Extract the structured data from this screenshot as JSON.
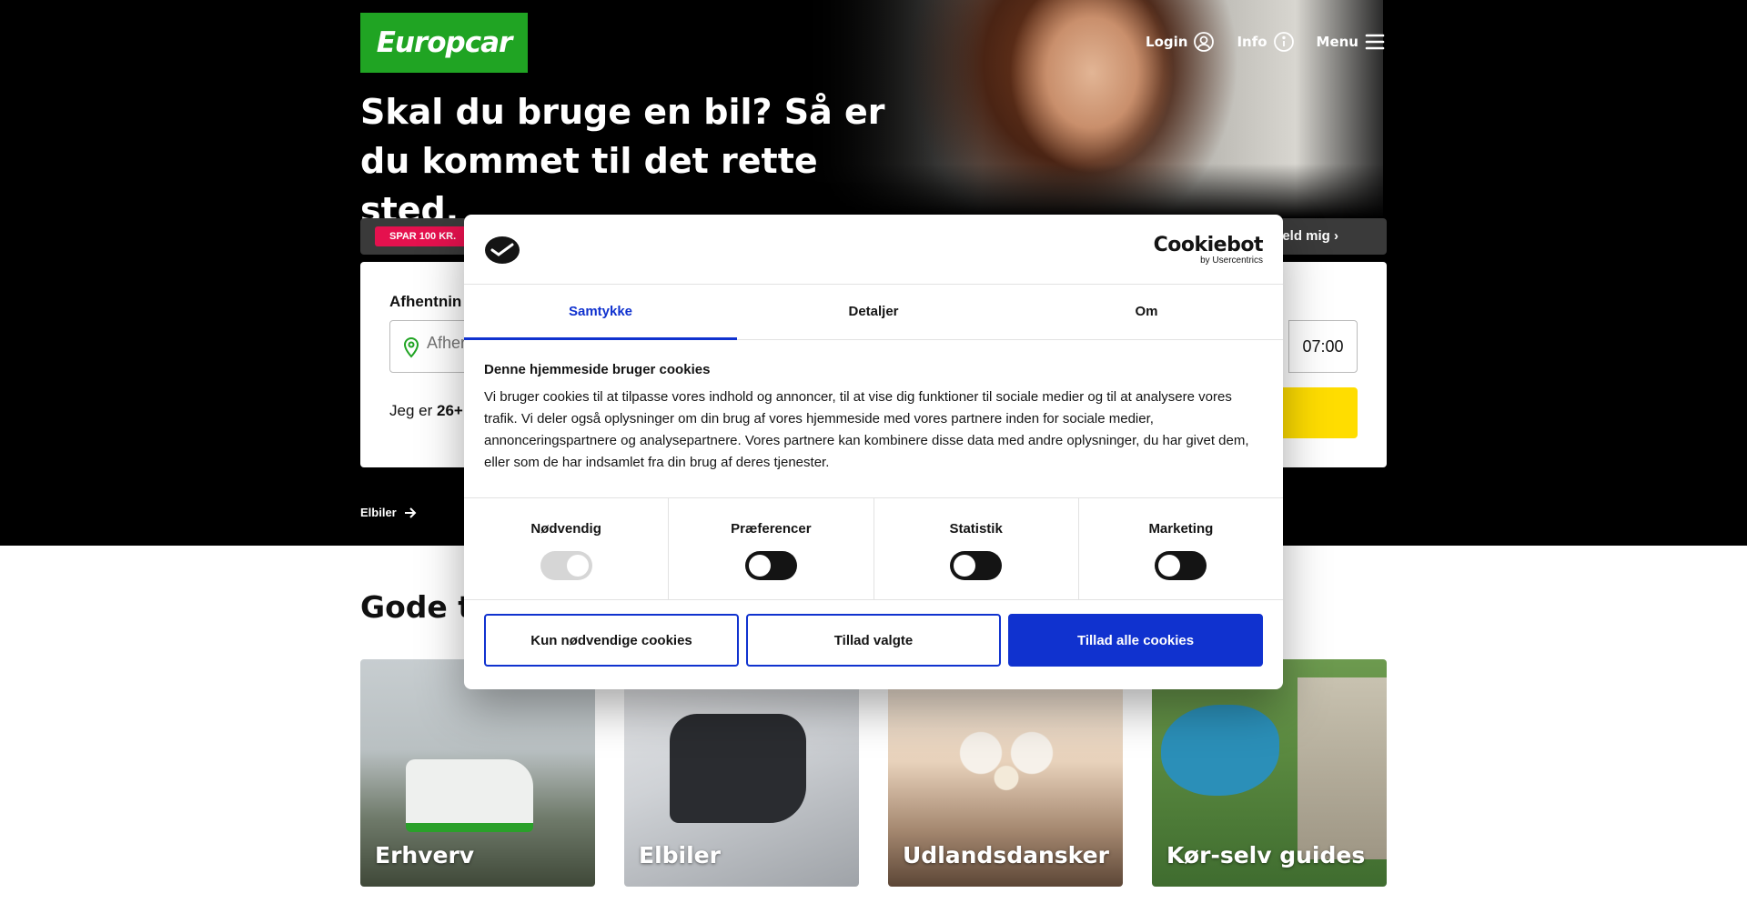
{
  "header": {
    "logo_text": "Europcar",
    "nav": [
      {
        "label": "Login",
        "icon": "user-icon"
      },
      {
        "label": "Info",
        "icon": "info-icon"
      },
      {
        "label": "Menu",
        "icon": "menu-icon"
      }
    ]
  },
  "hero": {
    "title": "Skal du bruge en bil? Så er du kommet til det rette sted."
  },
  "promo": {
    "badge": "SPAR 100 KR.",
    "link": "eld mig ›"
  },
  "booking": {
    "pickup_label": "Afhentnin",
    "pickup_placeholder": "Afher",
    "time": "07:00",
    "age_prefix": "Jeg er",
    "age_value": "26+"
  },
  "links": {
    "elbiler": "Elbiler"
  },
  "section": {
    "title": "Gode ti"
  },
  "cards": [
    {
      "label": "Erhverv"
    },
    {
      "label": "Elbiler"
    },
    {
      "label": "Udlandsdansker"
    },
    {
      "label": "Kør-selv guides"
    }
  ],
  "cookie_dialog": {
    "brand": "Cookiebot",
    "brand_sub": "by Usercentrics",
    "tabs": [
      "Samtykke",
      "Detaljer",
      "Om"
    ],
    "heading": "Denne hjemmeside bruger cookies",
    "body": "Vi bruger cookies til at tilpasse vores indhold og annoncer, til at vise dig funktioner til sociale medier og til at analysere vores trafik. Vi deler også oplysninger om din brug af vores hjemmeside med vores partnere inden for sociale medier, annonceringspartnere og analysepartnere. Vores partnere kan kombinere disse data med andre oplysninger, du har givet dem, eller som de har indsamlet fra din brug af deres tjenester.",
    "toggles": [
      {
        "label": "Nødvendig",
        "state": "on-disabled"
      },
      {
        "label": "Præferencer",
        "state": "off"
      },
      {
        "label": "Statistik",
        "state": "off"
      },
      {
        "label": "Marketing",
        "state": "off"
      }
    ],
    "buttons": [
      "Kun nødvendige cookies",
      "Tillad valgte",
      "Tillad alle cookies"
    ]
  },
  "colors": {
    "brand_green": "#20a423",
    "accent_blue": "#1032cf",
    "cta_yellow": "#ffdd00",
    "promo_red": "#e5114e"
  }
}
